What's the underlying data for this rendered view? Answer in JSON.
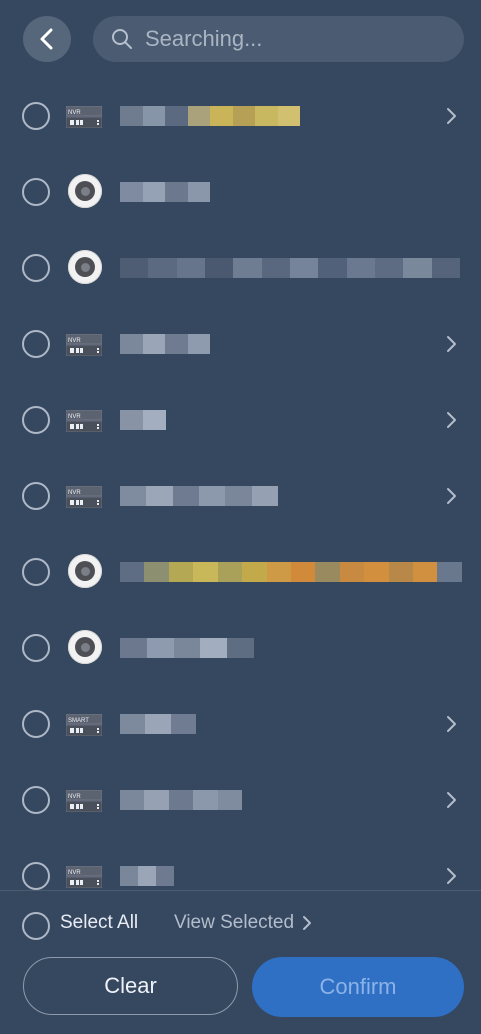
{
  "search": {
    "placeholder": "Searching..."
  },
  "devices": [
    {
      "type": "nvr",
      "label_tag": "NVR",
      "has_children": true
    },
    {
      "type": "camera",
      "has_children": false
    },
    {
      "type": "camera",
      "has_children": false
    },
    {
      "type": "nvr",
      "label_tag": "NVR",
      "has_children": true
    },
    {
      "type": "nvr",
      "label_tag": "NVR",
      "has_children": true
    },
    {
      "type": "nvr",
      "label_tag": "NVR",
      "has_children": true
    },
    {
      "type": "camera",
      "has_children": false
    },
    {
      "type": "camera",
      "has_children": false
    },
    {
      "type": "smart",
      "label_tag": "SMART",
      "has_children": true
    },
    {
      "type": "nvr",
      "label_tag": "NVR",
      "has_children": true
    },
    {
      "type": "nvr",
      "label_tag": "NVR",
      "has_children": true
    }
  ],
  "footer": {
    "select_all_label": "Select All",
    "view_selected_label": "View Selected",
    "clear_label": "Clear",
    "confirm_label": "Confirm"
  },
  "colors": {
    "background": "#364760",
    "confirm_button": "#2f6fc4",
    "confirm_text": "#8cb3e8"
  }
}
